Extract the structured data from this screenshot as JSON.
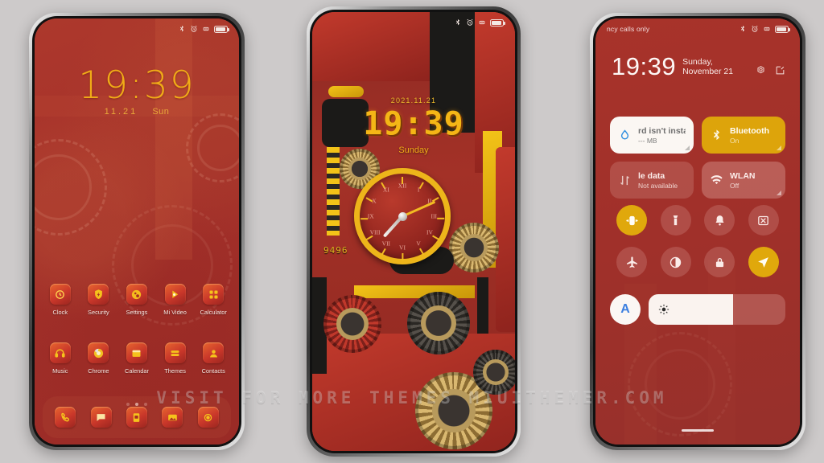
{
  "watermark": "VISIT FOR MORE THEMES        MIUITHEMER.COM",
  "colors": {
    "page_background": "#cdcaca",
    "theme_red": "#a6332b",
    "accent_gold": "#f0ab17",
    "tile_gold": "#dda40b",
    "tile_white": "#fbf7f3",
    "auto_brightness_blue": "#3b7fe0"
  },
  "phone1": {
    "name": "Home screen",
    "statusbar": {
      "left_text": "",
      "icons": [
        "bluetooth-icon",
        "alarm-icon",
        "vibrate-icon",
        "battery-icon"
      ]
    },
    "clock": "19:39",
    "date": "11.21",
    "weekday": "Sun",
    "apps_row1": [
      {
        "label": "Clock",
        "icon": "clock-icon"
      },
      {
        "label": "Security",
        "icon": "shield-icon"
      },
      {
        "label": "Settings",
        "icon": "settings-icon"
      },
      {
        "label": "Mi Video",
        "icon": "play-icon"
      },
      {
        "label": "Calculator",
        "icon": "calculator-icon"
      }
    ],
    "apps_row2": [
      {
        "label": "Music",
        "icon": "headphones-icon"
      },
      {
        "label": "Chrome",
        "icon": "chrome-icon"
      },
      {
        "label": "Calendar",
        "icon": "calendar-icon"
      },
      {
        "label": "Themes",
        "icon": "themes-icon"
      },
      {
        "label": "Contacts",
        "icon": "contact-icon"
      }
    ],
    "page_dots": {
      "count": 3,
      "active_index": 1
    },
    "dock": [
      {
        "label": "Phone",
        "icon": "phone-icon"
      },
      {
        "label": "Messages",
        "icon": "message-icon"
      },
      {
        "label": "Notes",
        "icon": "notes-icon"
      },
      {
        "label": "Gallery",
        "icon": "gallery-icon"
      },
      {
        "label": "Camera",
        "icon": "camera-icon"
      }
    ]
  },
  "phone2": {
    "name": "Lock screen",
    "statusbar": {
      "icons": [
        "bluetooth-icon",
        "alarm-icon",
        "vibrate-icon",
        "battery-icon"
      ]
    },
    "date": "2021.11.21",
    "time": "19:39",
    "weekday": "Sunday",
    "wallpaper_number": "9496",
    "analog_clock": {
      "numerals": [
        "XII",
        "XI",
        "X",
        "IX",
        "VIII",
        "VII",
        "VI",
        "V",
        "IV",
        "III",
        "II",
        "I"
      ],
      "hour_angle": 222,
      "minute_angle": 66
    }
  },
  "phone3": {
    "name": "Notification shade",
    "statusbar": {
      "left_text": "ncy calls only",
      "icons": [
        "bluetooth-icon",
        "alarm-icon",
        "vibrate-icon",
        "battery-icon"
      ]
    },
    "time": "19:39",
    "date": "Sunday, November 21",
    "header_icons": [
      "settings-gear-icon",
      "edit-icon"
    ],
    "big_tiles": [
      {
        "title": "rd isn't installe",
        "subtitle": "--- MB",
        "icon": "data-drop-icon",
        "state": "white"
      },
      {
        "title": "Bluetooth",
        "subtitle": "On",
        "icon": "bluetooth-icon",
        "state": "on"
      },
      {
        "title": "le data",
        "subtitle": "Not available",
        "icon": "data-arrows-icon",
        "state": "disabled"
      },
      {
        "title": "WLAN",
        "subtitle": "Off",
        "icon": "wifi-icon",
        "state": "off"
      }
    ],
    "toggles": [
      {
        "name": "Vibrate",
        "icon": "vibrate-icon",
        "active": true
      },
      {
        "name": "Flashlight",
        "icon": "flashlight-icon",
        "active": false
      },
      {
        "name": "Silent",
        "icon": "bell-icon",
        "active": false
      },
      {
        "name": "Screenshot",
        "icon": "scissors-icon",
        "active": false
      },
      {
        "name": "Airplane",
        "icon": "airplane-icon",
        "active": false
      },
      {
        "name": "Dark mode",
        "icon": "contrast-icon",
        "active": false
      },
      {
        "name": "Lock",
        "icon": "lock-icon",
        "active": false
      },
      {
        "name": "Location",
        "icon": "location-icon",
        "active": true
      }
    ],
    "brightness": {
      "auto_label": "A",
      "level_percent": 62,
      "icon": "sun-icon"
    }
  }
}
